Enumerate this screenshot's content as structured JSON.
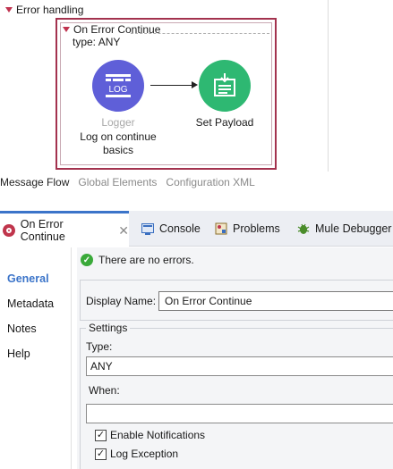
{
  "canvas": {
    "section_title": "Error handling",
    "scope": {
      "title": "On Error Continue",
      "type_label": "type: ANY"
    },
    "nodes": [
      {
        "type": "Logger",
        "label": "Log on continue basics",
        "icon": "log-icon"
      },
      {
        "type": "",
        "label": "Set Payload",
        "icon": "set-payload-icon"
      }
    ],
    "node_colors": {
      "logger": "#5f5fd8",
      "set_payload": "#2eb872",
      "scope_border": "#a3324e"
    }
  },
  "editor_tabs": [
    "Message Flow",
    "Global Elements",
    "Configuration XML"
  ],
  "panel_tabs": [
    {
      "label": "On Error Continue",
      "icon": "error-handler-icon",
      "active": true
    },
    {
      "label": "Console",
      "icon": "console-icon"
    },
    {
      "label": "Problems",
      "icon": "problems-icon"
    },
    {
      "label": "Mule Debugger",
      "icon": "debugger-icon"
    }
  ],
  "side_nav": [
    {
      "label": "General",
      "active": true
    },
    {
      "label": "Metadata"
    },
    {
      "label": "Notes"
    },
    {
      "label": "Help"
    }
  ],
  "properties": {
    "status": "There are no errors.",
    "display_name_label": "Display Name:",
    "display_name_value": "On Error Continue",
    "settings_title": "Settings",
    "type_label": "Type:",
    "type_value": "ANY",
    "when_label": "When:",
    "when_value": "",
    "enable_notifications_label": "Enable Notifications",
    "enable_notifications_checked": true,
    "log_exception_label": "Log Exception",
    "log_exception_checked": true
  },
  "colors": {
    "accent": "#3b74c9",
    "ok": "#3aaa3a"
  }
}
